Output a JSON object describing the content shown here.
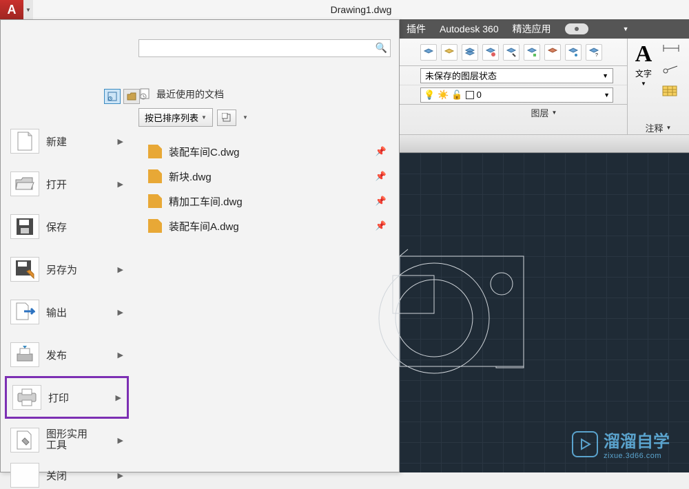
{
  "app_title": "Drawing1.dwg",
  "app_letter": "A",
  "menubar": {
    "plugins": "插件",
    "autodesk360": "Autodesk 360",
    "featured": "精选应用"
  },
  "app_menu": {
    "search_placeholder": "",
    "items": [
      {
        "label": "新建"
      },
      {
        "label": "打开"
      },
      {
        "label": "保存",
        "no_arrow": true
      },
      {
        "label": "另存为"
      },
      {
        "label": "输出"
      },
      {
        "label": "发布"
      },
      {
        "label": "打印",
        "highlight": true
      },
      {
        "label": "图形实用",
        "label2": "工具"
      },
      {
        "label": "关闭"
      }
    ]
  },
  "recent": {
    "title": "最近使用的文档",
    "sort_label": "按已排序列表",
    "files": [
      {
        "name": "装配车间C.dwg"
      },
      {
        "name": "新块.dwg"
      },
      {
        "name": "精加工车间.dwg"
      },
      {
        "name": "装配车间A.dwg"
      }
    ]
  },
  "ribbon": {
    "layer_state": "未保存的图层状态",
    "layer_current": "0",
    "layer_panel_label": "图层",
    "annot_label": "文字",
    "annot_label2": "注释"
  },
  "watermark": {
    "text": "溜溜自学",
    "sub": "zixue.3d66.com"
  }
}
